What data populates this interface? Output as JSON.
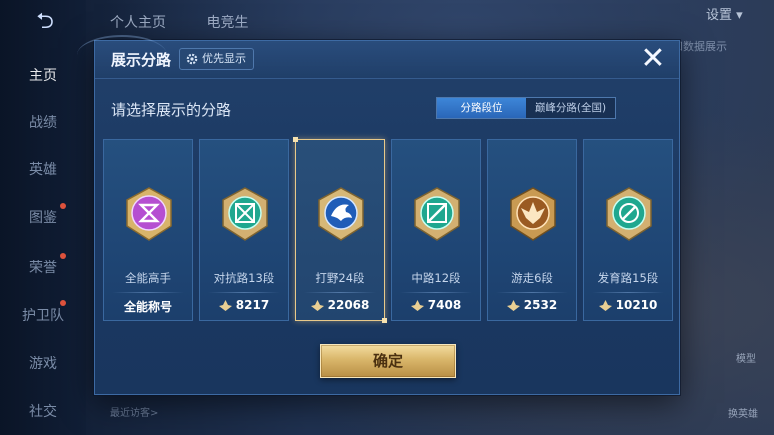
{
  "background": {
    "nav": [
      {
        "label": "主页",
        "active": true
      },
      {
        "label": "战绩"
      },
      {
        "label": "英雄"
      },
      {
        "label": "图鉴"
      },
      {
        "label": "荣誉"
      },
      {
        "label": "护卫队"
      },
      {
        "label": "游戏"
      },
      {
        "label": "社交"
      }
    ],
    "top_tabs": [
      "个人主页",
      "电竞生"
    ],
    "settings_label": "设置",
    "right_hint": "和数据展示",
    "model_label": "模型",
    "hero_label": "换英雄",
    "visitors_label": "最近访客>"
  },
  "dialog": {
    "title": "展示分路",
    "priority_label": "优先显示",
    "close_glyph": "✕",
    "prompt": "请选择展示的分路",
    "toggle": {
      "options": [
        "分路段位",
        "巅峰分路(全国)"
      ],
      "selected_index": 0
    },
    "cards": [
      {
        "rank": "全能高手",
        "stat": "全能称号",
        "stat_has_icon": false,
        "emblem": "purple-knot-emblem"
      },
      {
        "rank": "对抗路13段",
        "stat": "8217",
        "stat_has_icon": true,
        "emblem": "green-cross-emblem"
      },
      {
        "rank": "打野24段",
        "stat": "22068",
        "stat_has_icon": true,
        "emblem": "blue-dragon-emblem",
        "selected": true
      },
      {
        "rank": "中路12段",
        "stat": "7408",
        "stat_has_icon": true,
        "emblem": "green-slash-emblem"
      },
      {
        "rank": "游走6段",
        "stat": "2532",
        "stat_has_icon": true,
        "emblem": "gold-wing-emblem"
      },
      {
        "rank": "发育路15段",
        "stat": "10210",
        "stat_has_icon": true,
        "emblem": "green-target-emblem"
      }
    ],
    "confirm_label": "确定"
  },
  "colors": {
    "accent_gold": "#e8c98a",
    "toggle_blue": "#3d86d8",
    "dialog_bg": "#1f3f68"
  }
}
